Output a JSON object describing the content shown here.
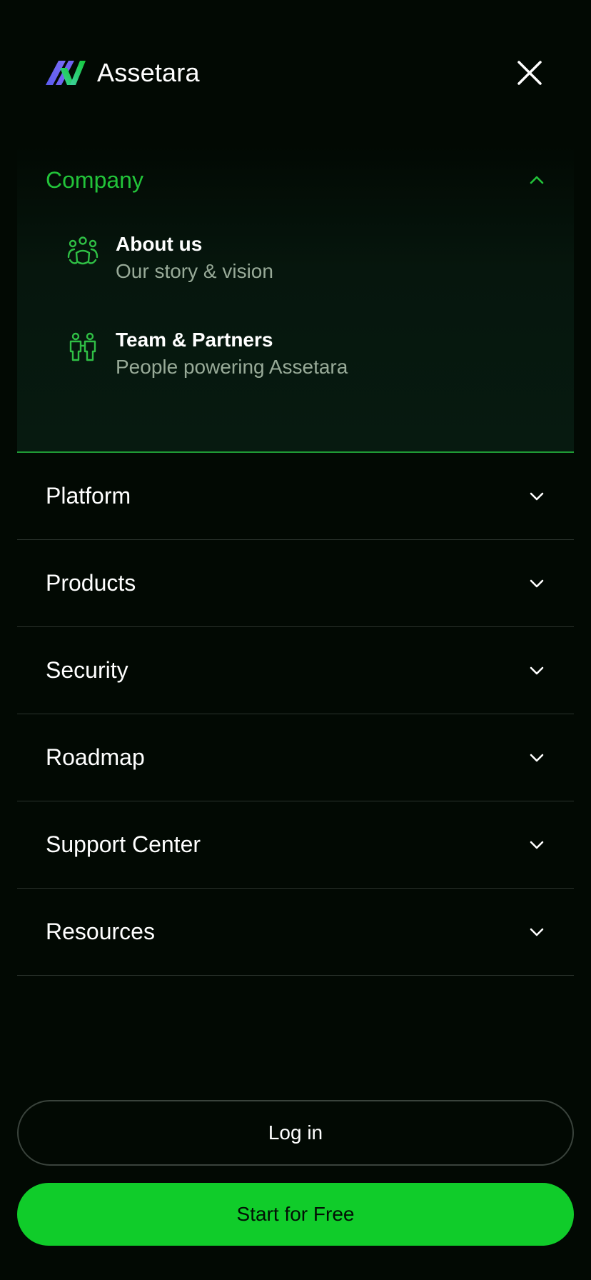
{
  "brand": {
    "name": "Assetara",
    "logo_colors": [
      "#5b5cf0",
      "#3fd0a0",
      "#14c93a"
    ]
  },
  "header": {
    "close_icon": "close-icon"
  },
  "expanded_section": {
    "label": "Company",
    "icon": "chevron-up-icon",
    "accent_color": "#22c339",
    "items": [
      {
        "title": "About us",
        "description": "Our story & vision",
        "icon": "team-group-icon"
      },
      {
        "title": "Team & Partners",
        "description": "People powering Assetara",
        "icon": "partners-icon"
      }
    ]
  },
  "nav": {
    "items": [
      {
        "label": "Platform",
        "icon": "chevron-down-icon"
      },
      {
        "label": "Products",
        "icon": "chevron-down-icon"
      },
      {
        "label": "Security",
        "icon": "chevron-down-icon"
      },
      {
        "label": "Roadmap",
        "icon": "chevron-down-icon"
      },
      {
        "label": "Support Center",
        "icon": "chevron-down-icon"
      },
      {
        "label": "Resources",
        "icon": "chevron-down-icon"
      }
    ]
  },
  "actions": {
    "login_label": "Log in",
    "start_label": "Start for Free",
    "start_color": "#10cc2a"
  }
}
